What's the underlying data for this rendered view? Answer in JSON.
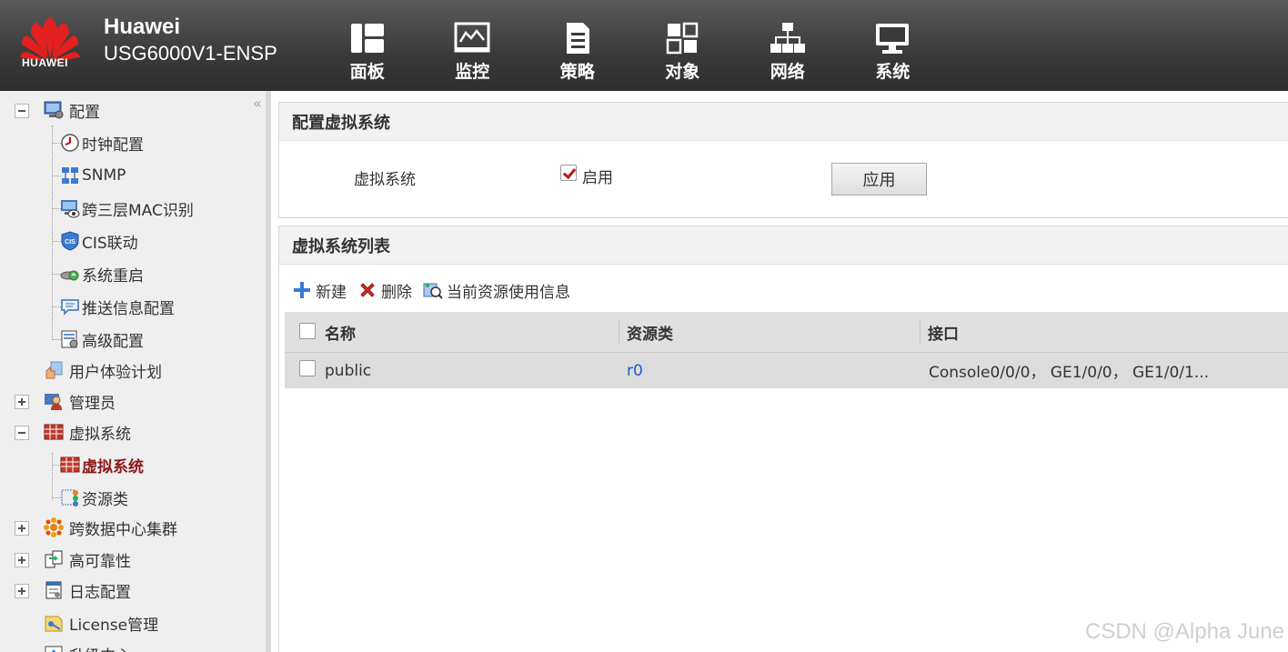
{
  "header": {
    "brand_name": "Huawei",
    "device_model": "USG6000V1-ENSP",
    "logo_text": "HUAWEI",
    "nav": [
      {
        "label": "面板",
        "icon": "dashboard-icon"
      },
      {
        "label": "监控",
        "icon": "monitor-chart-icon"
      },
      {
        "label": "策略",
        "icon": "policy-document-icon"
      },
      {
        "label": "对象",
        "icon": "objects-icon"
      },
      {
        "label": "网络",
        "icon": "network-topology-icon"
      },
      {
        "label": "系统",
        "icon": "system-monitor-icon"
      }
    ]
  },
  "sidebar": {
    "collapse_glyph": "«",
    "items": [
      {
        "label": "配置"
      },
      {
        "label": "时钟配置"
      },
      {
        "label": "SNMP"
      },
      {
        "label": "跨三层MAC识别"
      },
      {
        "label": "CIS联动"
      },
      {
        "label": "系统重启"
      },
      {
        "label": "推送信息配置"
      },
      {
        "label": "高级配置"
      },
      {
        "label": "用户体验计划"
      },
      {
        "label": "管理员"
      },
      {
        "label": "虚拟系统"
      },
      {
        "label": "虚拟系统"
      },
      {
        "label": "资源类"
      },
      {
        "label": "跨数据中心集群"
      },
      {
        "label": "高可靠性"
      },
      {
        "label": "日志配置"
      },
      {
        "label": "License管理"
      },
      {
        "label": "升级中心"
      }
    ]
  },
  "config_panel": {
    "title": "配置虚拟系统",
    "field_label": "虚拟系统",
    "enable_label": "启用",
    "enable_checked": true,
    "apply_label": "应用"
  },
  "list_panel": {
    "title": "虚拟系统列表",
    "toolbar": {
      "new_label": "新建",
      "delete_label": "删除",
      "resource_info_label": "当前资源使用信息"
    },
    "columns": [
      "名称",
      "资源类",
      "接口"
    ],
    "rows": [
      {
        "name": "public",
        "resource_class": "r0",
        "interfaces": "Console0/0/0， GE1/0/0， GE1/0/1..."
      }
    ]
  },
  "watermark": "CSDN @Alpha June",
  "colors": {
    "header_bg": "#3a3a3a",
    "accent_red": "#b01c1c",
    "link_blue": "#1a5fcc"
  }
}
